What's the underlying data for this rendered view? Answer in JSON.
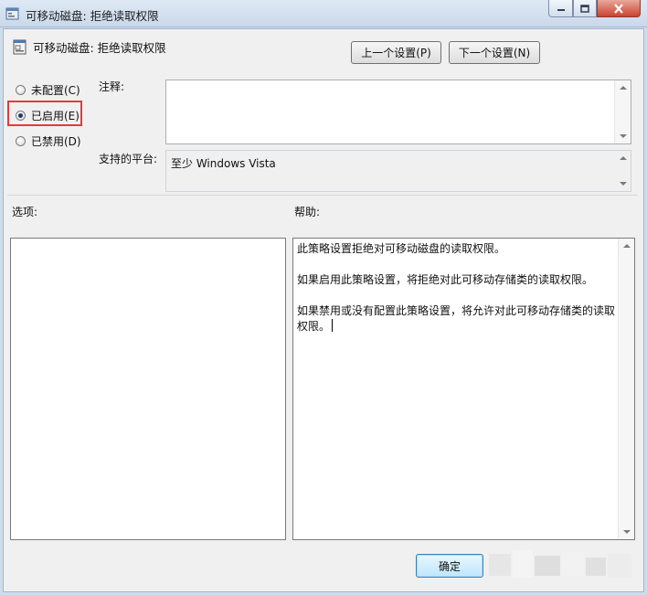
{
  "window": {
    "title": "可移动磁盘: 拒绝读取权限"
  },
  "header": {
    "policy_title": "可移动磁盘: 拒绝读取权限",
    "prev_button": "上一个设置(P)",
    "next_button": "下一个设置(N)"
  },
  "state": {
    "options": [
      {
        "label": "未配置(C)",
        "checked": false
      },
      {
        "label": "已启用(E)",
        "checked": true
      },
      {
        "label": "已禁用(D)",
        "checked": false
      }
    ],
    "highlight_color": "#e23b3b"
  },
  "comment": {
    "label": "注释:",
    "value": ""
  },
  "platform": {
    "label": "支持的平台:",
    "value": "至少 Windows Vista"
  },
  "options_section": {
    "label": "选项:"
  },
  "help": {
    "label": "帮助:",
    "paragraphs": [
      "此策略设置拒绝对可移动磁盘的读取权限。",
      "如果启用此策略设置，将拒绝对此可移动存储类的读取权限。",
      "如果禁用或没有配置此策略设置，将允许对此可移动存储类的读取权限。"
    ]
  },
  "footer": {
    "ok_button": "确定"
  },
  "icons": {
    "title": "policy-setting-icon",
    "minimize": "minimize-icon",
    "maximize": "maximize-icon",
    "close": "close-icon"
  }
}
